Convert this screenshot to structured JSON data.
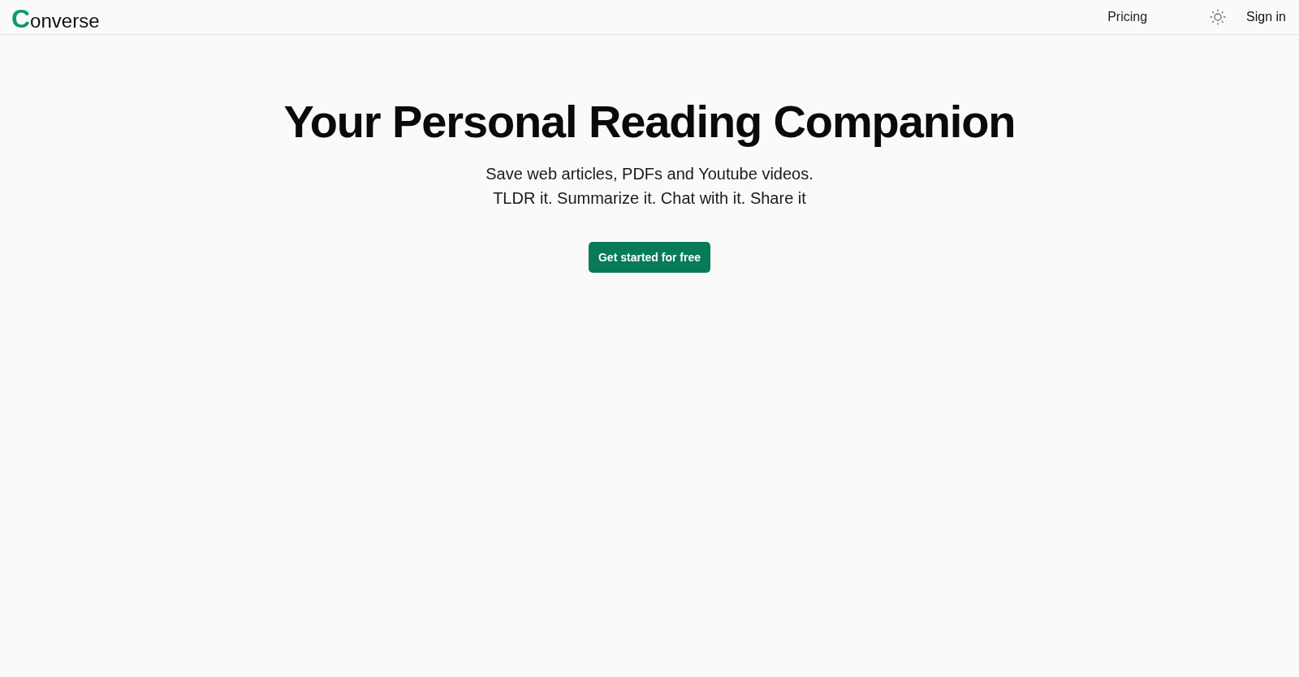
{
  "header": {
    "logo": {
      "initial": "C",
      "text": "onverse"
    },
    "nav": [
      {
        "label": "Pricing"
      }
    ],
    "sign_in": "Sign in"
  },
  "hero": {
    "title": "Your Personal Reading Companion",
    "subtitle_lines": [
      "Save web articles, PDFs and Youtube videos.",
      "TLDR it. Summarize it. Chat with it. Share it"
    ],
    "cta": "Get started for free"
  }
}
